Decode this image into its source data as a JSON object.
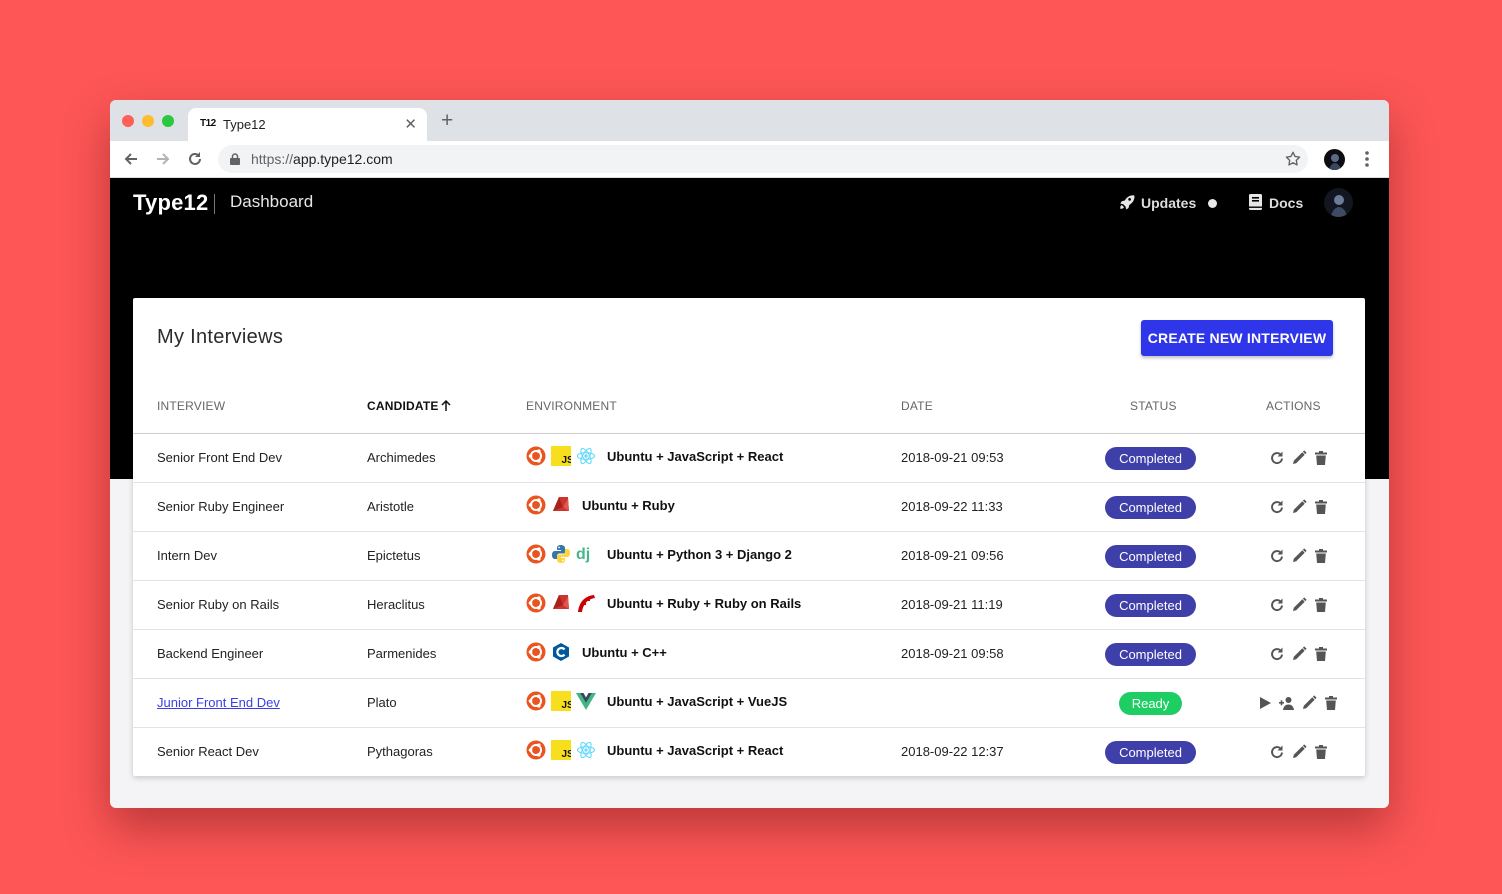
{
  "browser": {
    "favicon_text": "T12",
    "tab_title": "Type12",
    "url_scheme": "https://",
    "url_host": "app.type12.com"
  },
  "header": {
    "brand": "Type12",
    "page": "Dashboard",
    "updates_label": "Updates",
    "docs_label": "Docs"
  },
  "card": {
    "title": "My Interviews",
    "create_button": "CREATE NEW INTERVIEW"
  },
  "columns": {
    "interview": "INTERVIEW",
    "candidate": "CANDIDATE",
    "environment": "ENVIRONMENT",
    "date": "DATE",
    "status": "STATUS",
    "actions": "ACTIONS"
  },
  "rows": [
    {
      "interview": "Senior Front End Dev",
      "candidate": "Archimedes",
      "icons": [
        "ubuntu-icon",
        "javascript-icon",
        "react-icon"
      ],
      "environment": "Ubuntu + JavaScript + React",
      "date": "2018-09-21 09:53",
      "status": "Completed"
    },
    {
      "interview": "Senior Ruby Engineer",
      "candidate": "Aristotle",
      "icons": [
        "ubuntu-icon",
        "ruby-icon"
      ],
      "environment": "Ubuntu + Ruby",
      "date": "2018-09-22 11:33",
      "status": "Completed"
    },
    {
      "interview": "Intern Dev",
      "candidate": "Epictetus",
      "icons": [
        "ubuntu-icon",
        "python-icon",
        "django-icon"
      ],
      "environment": "Ubuntu + Python 3 + Django 2",
      "date": "2018-09-21 09:56",
      "status": "Completed"
    },
    {
      "interview": "Senior Ruby on Rails",
      "candidate": "Heraclitus",
      "icons": [
        "ubuntu-icon",
        "ruby-icon",
        "rails-icon"
      ],
      "environment": "Ubuntu + Ruby + Ruby on Rails",
      "date": "2018-09-21 11:19",
      "status": "Completed"
    },
    {
      "interview": "Backend Engineer",
      "candidate": "Parmenides",
      "icons": [
        "ubuntu-icon",
        "cpp-icon"
      ],
      "environment": "Ubuntu + C++",
      "date": "2018-09-21 09:58",
      "status": "Completed"
    },
    {
      "interview": "Junior Front End Dev",
      "candidate": "Plato",
      "icons": [
        "ubuntu-icon",
        "javascript-icon",
        "vue-icon"
      ],
      "environment": "Ubuntu + JavaScript + VueJS",
      "date": "",
      "status": "Ready"
    },
    {
      "interview": "Senior React Dev",
      "candidate": "Pythagoras",
      "icons": [
        "ubuntu-icon",
        "javascript-icon",
        "react-icon"
      ],
      "environment": "Ubuntu + JavaScript + React",
      "date": "2018-09-22 12:37",
      "status": "Completed"
    }
  ],
  "colors": {
    "background": "#fe5656",
    "primary_button": "#2f35e9",
    "completed_badge": "#3f3fa9",
    "ready_badge": "#1fce63",
    "link": "#3b3ee6"
  }
}
